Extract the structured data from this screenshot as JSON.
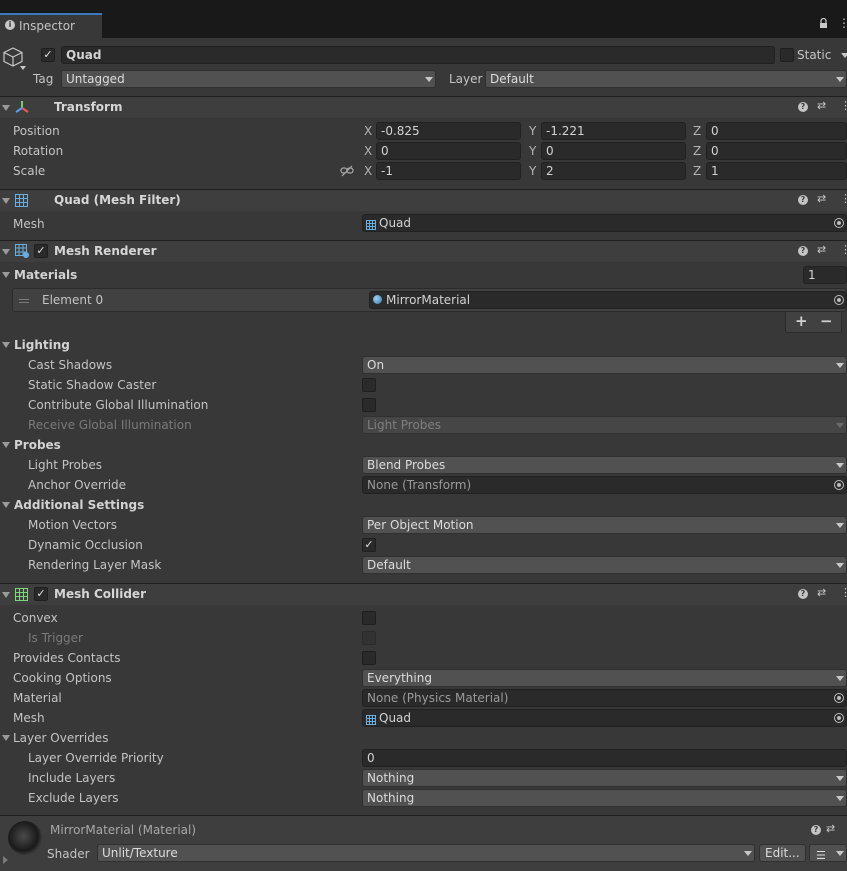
{
  "tab": {
    "label": "Inspector"
  },
  "object": {
    "name": "Quad",
    "static_label": "Static",
    "tag_label": "Tag",
    "tag_value": "Untagged",
    "layer_label": "Layer",
    "layer_value": "Default"
  },
  "transform": {
    "title": "Transform",
    "position_label": "Position",
    "rotation_label": "Rotation",
    "scale_label": "Scale",
    "axis_x": "X",
    "axis_y": "Y",
    "axis_z": "Z",
    "position": {
      "x": "-0.825",
      "y": "-1.221",
      "z": "0"
    },
    "rotation": {
      "x": "0",
      "y": "0",
      "z": "0"
    },
    "scale": {
      "x": "-1",
      "y": "2",
      "z": "1"
    }
  },
  "mesh_filter": {
    "title": "Quad (Mesh Filter)",
    "mesh_label": "Mesh",
    "mesh_value": "Quad"
  },
  "mesh_renderer": {
    "title": "Mesh Renderer",
    "materials_label": "Materials",
    "materials_count": "1",
    "element_label": "Element 0",
    "element_value": "MirrorMaterial",
    "add_label": "+",
    "remove_label": "−",
    "lighting_label": "Lighting",
    "cast_shadows_label": "Cast Shadows",
    "cast_shadows_value": "On",
    "static_shadow_label": "Static Shadow Caster",
    "contribute_gi_label": "Contribute Global Illumination",
    "receive_gi_label": "Receive Global Illumination",
    "receive_gi_value": "Light Probes",
    "probes_label": "Probes",
    "light_probes_label": "Light Probes",
    "light_probes_value": "Blend Probes",
    "anchor_label": "Anchor Override",
    "anchor_value": "None (Transform)",
    "additional_label": "Additional Settings",
    "motion_label": "Motion Vectors",
    "motion_value": "Per Object Motion",
    "occlusion_label": "Dynamic Occlusion",
    "rendering_mask_label": "Rendering Layer Mask",
    "rendering_mask_value": "Default"
  },
  "mesh_collider": {
    "title": "Mesh Collider",
    "convex_label": "Convex",
    "is_trigger_label": "Is Trigger",
    "contacts_label": "Provides Contacts",
    "cooking_label": "Cooking Options",
    "cooking_value": "Everything",
    "material_label": "Material",
    "material_value": "None (Physics Material)",
    "mesh_label": "Mesh",
    "mesh_value": "Quad",
    "overrides_label": "Layer Overrides",
    "priority_label": "Layer Override Priority",
    "priority_value": "0",
    "include_label": "Include Layers",
    "include_value": "Nothing",
    "exclude_label": "Exclude Layers",
    "exclude_value": "Nothing"
  },
  "material": {
    "title": "MirrorMaterial (Material)",
    "shader_label": "Shader",
    "shader_value": "Unlit/Texture",
    "edit_label": "Edit..."
  }
}
